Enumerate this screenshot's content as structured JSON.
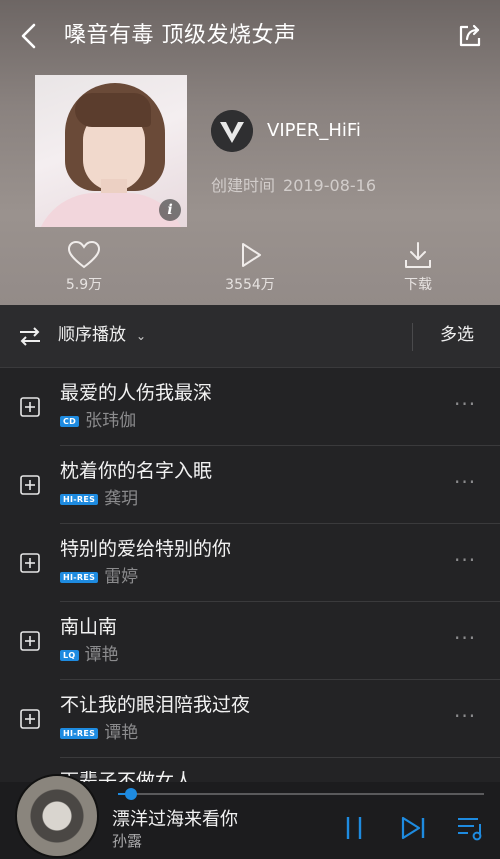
{
  "header": {
    "title": "嗓音有毒 顶级发烧女声",
    "creator": "VIPER_HiFi",
    "created_label": "创建时间",
    "created_date": "2019-08-16",
    "stats": {
      "likes": "5.9万",
      "plays": "3554万",
      "download": "下载"
    }
  },
  "toolbar": {
    "play_order": "顺序播放",
    "multi_select": "多选"
  },
  "songs": [
    {
      "title": "最爱的人伤我最深",
      "badge": "CD",
      "artist": "张玮伽"
    },
    {
      "title": "枕着你的名字入眠",
      "badge": "HI-RES",
      "artist": "龚玥"
    },
    {
      "title": "特别的爱给特别的你",
      "badge": "HI-RES",
      "artist": "雷婷"
    },
    {
      "title": "南山南",
      "badge": "LQ",
      "artist": "谭艳"
    },
    {
      "title": "不让我的眼泪陪我过夜",
      "badge": "HI-RES",
      "artist": "谭艳"
    },
    {
      "title": "下辈子不做女人",
      "badge": "",
      "artist": ""
    }
  ],
  "player": {
    "song": "漂洋过海来看你",
    "artist": "孙露",
    "progress": 0.02
  },
  "colors": {
    "accent": "#1e8be0",
    "background": "#232325"
  }
}
